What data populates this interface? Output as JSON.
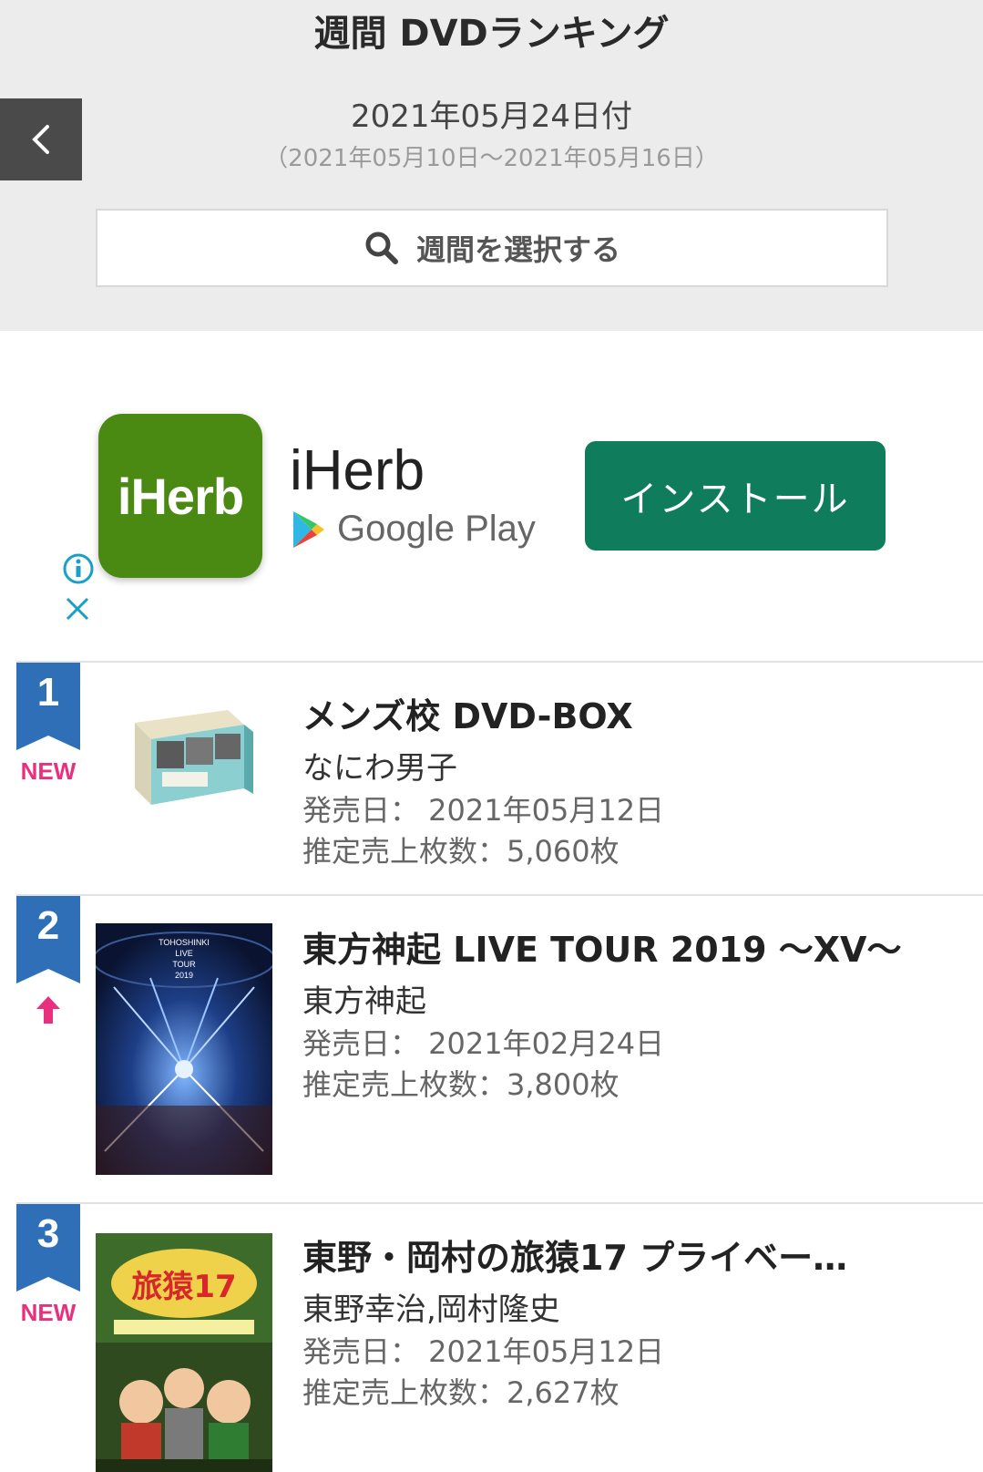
{
  "header": {
    "title": "週間 DVDランキング",
    "date": "2021年05月24日付",
    "range": "（2021年05月10日～2021年05月16日）",
    "week_select_label": "週間を選択する"
  },
  "ad": {
    "icon_text": "iHerb",
    "app_name": "iHerb",
    "store": "Google Play",
    "install_label": "インストール"
  },
  "rankings": [
    {
      "rank": "1",
      "status": "NEW",
      "title": "メンズ校 DVD-BOX",
      "artist": "なにわ男子",
      "release": "発売日： 2021年05月12日",
      "sales": "推定売上枚数：5,060枚"
    },
    {
      "rank": "2",
      "status": "up",
      "title": "東方神起 LIVE TOUR 2019 ～XV～",
      "artist": "東方神起",
      "release": "発売日： 2021年02月24日",
      "sales": "推定売上枚数：3,800枚",
      "cover_text": "TOHOSHINKI LIVE TOUR 2019"
    },
    {
      "rank": "3",
      "status": "NEW",
      "title": "東野・岡村の旅猿17 プライベー…",
      "artist": "東野幸治,岡村隆史",
      "release": "発売日： 2021年05月12日",
      "sales": "推定売上枚数：2,627枚",
      "cover_text": "旅猿17"
    }
  ],
  "colors": {
    "badge_blue": "#2f6fb8",
    "status_pink": "#e8307e",
    "install_green": "#0f7d5b",
    "iherb_green": "#4a8a12"
  }
}
